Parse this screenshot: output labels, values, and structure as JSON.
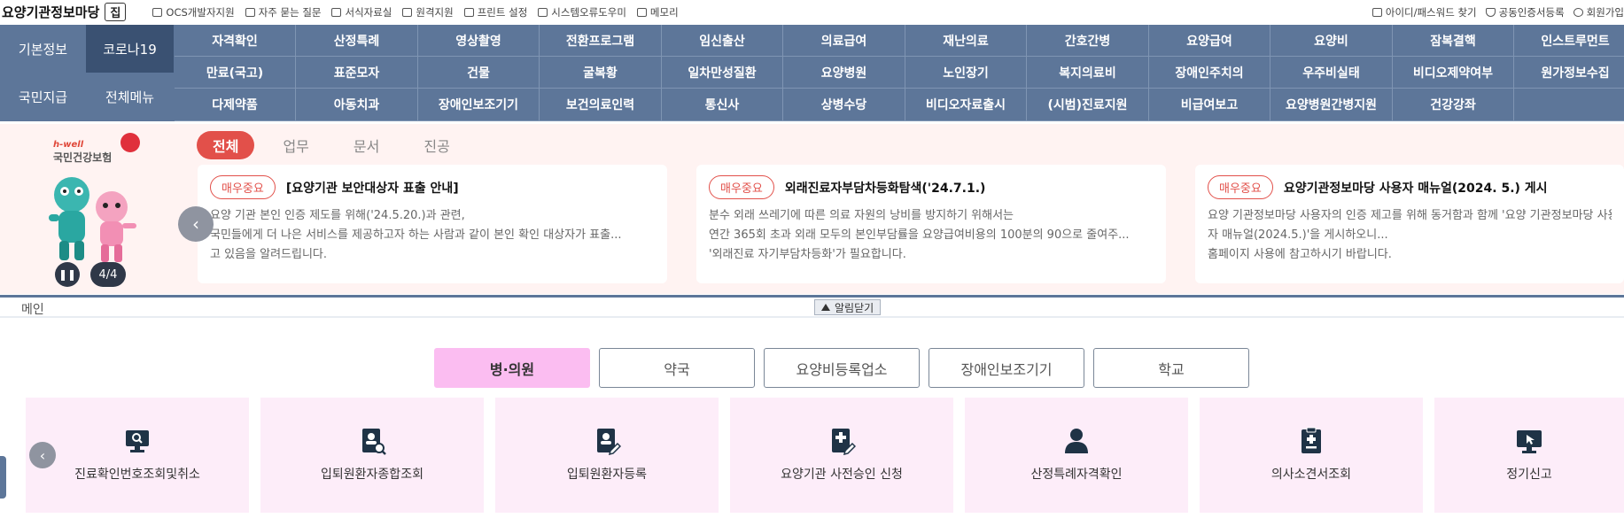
{
  "header": {
    "brand": "요양기관정보마당",
    "brand_box": "집",
    "links": [
      "OCS개발자지원",
      "자주 묻는 질문",
      "서식자료실",
      "원격지원",
      "프린트 설정",
      "시스템오류도우미",
      "메모리"
    ],
    "right_links": [
      "아이디/패스워드 찾기",
      "공동인증서등록",
      "회원가입"
    ]
  },
  "nav": {
    "left": [
      "기본정보",
      "코로나19",
      "국민지급",
      "전체메뉴"
    ],
    "rows": [
      [
        "자격확인",
        "산정특례",
        "영상촬영",
        "전환프로그램",
        "임신출산",
        "의료급여",
        "재난의료",
        "간호간병",
        "요양급여",
        "요양비",
        "잠복결핵",
        "인스트루먼트"
      ],
      [
        "만료(국고)",
        "표준모자",
        "건물",
        "굴복황",
        "일차만성질환",
        "요양병원",
        "노인장기",
        "복지의료비",
        "장애인주치의",
        "우주비실태",
        "비디오제약여부",
        "원가정보수집"
      ],
      [
        "다제약품",
        "아동치과",
        "장애인보조기기",
        "보건의료인력",
        "통신사",
        "상병수당",
        "비디오자료출시",
        "(시범)진료지원",
        "비급여보고",
        "요양병원간병지원",
        "건강강좌",
        ""
      ]
    ]
  },
  "notice": {
    "logo_top": "h-well",
    "logo_name": "국민건강보험",
    "pager": "4/4",
    "tabs": [
      "전체",
      "업무",
      "문서",
      "진공"
    ],
    "cards": [
      {
        "badge": "매우중요",
        "title": "[요양기관 보안대상자 표출 안내]",
        "lines": [
          "요양 기관 본인 인증 제도를 위해('24.5.20.)과 관련,",
          "국민들에게 더 나은 서비스를 제공하고자 하는 사람과 같이 본인 확인 대상자가 표출...",
          "고 있음을 알려드립니다."
        ]
      },
      {
        "badge": "매우중요",
        "title": "외래진료자부담차등화탐색('24.7.1.)",
        "lines": [
          "분수 외래 쓰레기에 따른 의료 자원의 낭비를 방지하기 위해서는",
          "연간 365회 초과 외래 모두의 본인부담률을 요양급여비용의 100분의 90으로 줄여주...",
          "'외래진료 자기부담차등화'가 필요합니다."
        ]
      },
      {
        "badge": "매우중요",
        "title": "요양기관정보마당 사용자 매뉴얼(2024. 5.) 게시",
        "lines": [
          "요양 기관정보마당 사용자의 인증 제고를 위해 동거함과 함께 '요양 기관정보마당 사용",
          "자 매뉴얼(2024.5.)'을 게시하오니...",
          "홈페이지 사용에 참고하시기 바랍니다."
        ]
      }
    ]
  },
  "main": {
    "label": "메인",
    "close_label": "알림닫기",
    "segments": [
      "병·의원",
      "약국",
      "요양비등록업소",
      "장애인보조기기",
      "학교"
    ],
    "services": [
      {
        "label": "진료확인번호조회및취소",
        "icon": "monitor-search-icon"
      },
      {
        "label": "입퇴원환자종합조회",
        "icon": "doc-search-icon"
      },
      {
        "label": "입퇴원환자등록",
        "icon": "doc-edit-icon"
      },
      {
        "label": "요양기관 사전승인 신청",
        "icon": "doc-plus-icon"
      },
      {
        "label": "산정특례자격확인",
        "icon": "person-icon"
      },
      {
        "label": "의사소견서조회",
        "icon": "clipboard-plus-icon"
      },
      {
        "label": "정기신고",
        "icon": "monitor-cursor-icon"
      }
    ]
  },
  "colors": {
    "nav_bg": "#5d7699",
    "nav_active": "#3a5172",
    "accent_red": "#e2504a",
    "segment_active": "#fbbdf1",
    "service_bg": "#fdedf9",
    "icon_dark": "#1f3346"
  }
}
